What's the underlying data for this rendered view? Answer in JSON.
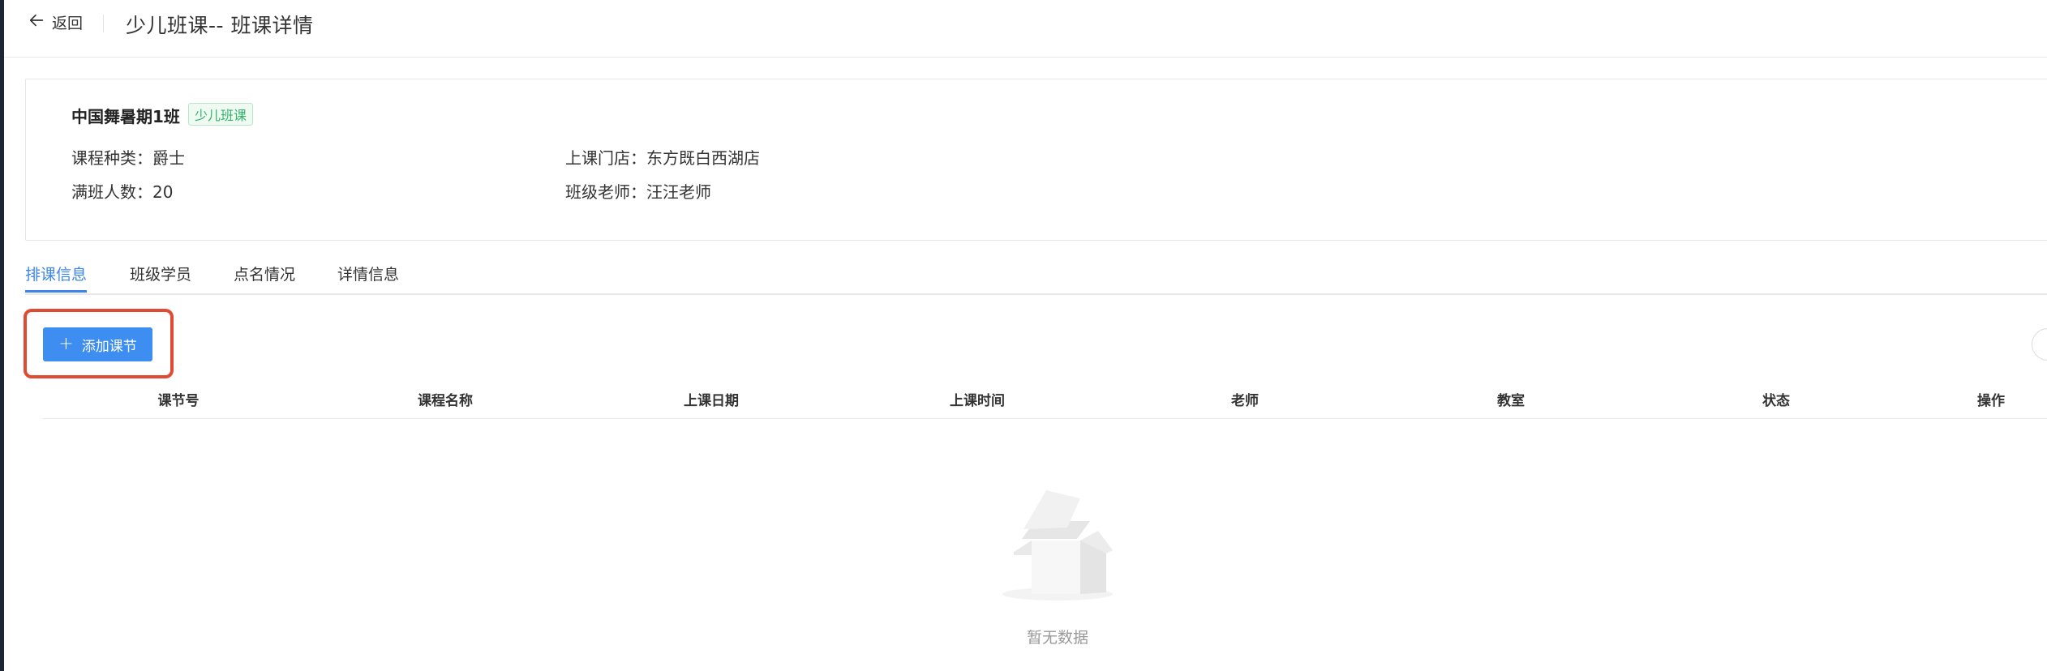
{
  "header": {
    "back_label": "返回",
    "title": "少儿班课-- 班课详情"
  },
  "class_info": {
    "name": "中国舞暑期1班",
    "tag": "少儿班课",
    "course_type_label": "课程种类：",
    "course_type_value": "爵士",
    "store_label": "上课门店：",
    "store_value": "东方既白西湖店",
    "capacity_label": "满班人数：",
    "capacity_value": "20",
    "teacher_label": "班级老师：",
    "teacher_value": "汪汪老师"
  },
  "tabs": [
    {
      "label": "排课信息",
      "active": true
    },
    {
      "label": "班级学员",
      "active": false
    },
    {
      "label": "点名情况",
      "active": false
    },
    {
      "label": "详情信息",
      "active": false
    }
  ],
  "toolbar": {
    "add_label": "添加课节"
  },
  "table": {
    "columns": [
      "课节号",
      "课程名称",
      "上课日期",
      "上课时间",
      "老师",
      "教室",
      "状态",
      "操作"
    ],
    "empty_text": "暂无数据"
  },
  "colors": {
    "accent": "#3d8ef0",
    "tag_green": "#32b56a",
    "highlight_red": "#e04a32"
  }
}
